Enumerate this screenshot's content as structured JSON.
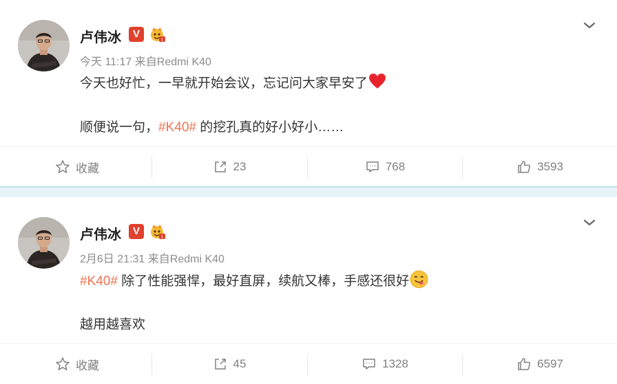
{
  "posts": [
    {
      "username": "卢伟冰",
      "verified_badge": "V",
      "time": "今天 11:17",
      "source_prefix": "来自",
      "source": "Redmi K40",
      "line1": "今天也好忙，一早就开始会议，忘记问大家早安了",
      "line1_emoji": "red-heart-icon",
      "line2_prefix": "顺便说一句，",
      "line2_topic": "#K40#",
      "line2_suffix": " 的挖孔真的好小好小……",
      "favorite_label": "收藏",
      "repost_count": "23",
      "comment_count": "768",
      "like_count": "3593"
    },
    {
      "username": "卢伟冰",
      "verified_badge": "V",
      "time": "2月6日 21:31",
      "source_prefix": "来自",
      "source": "Redmi K40",
      "line1_topic": "#K40#",
      "line1_suffix": " 除了性能强悍，最好直屏，续航又棒，手感还很好",
      "line1_emoji": "yum-face-icon",
      "line2": "越用越喜欢",
      "favorite_label": "收藏",
      "repost_count": "45",
      "comment_count": "1328",
      "like_count": "6597"
    }
  ],
  "colors": {
    "topic": "#eb7350",
    "verified": "#e0412d",
    "separator": "#e8f3f7",
    "separator_border": "#bfe2ec",
    "meta_text": "#8c8c8c"
  }
}
